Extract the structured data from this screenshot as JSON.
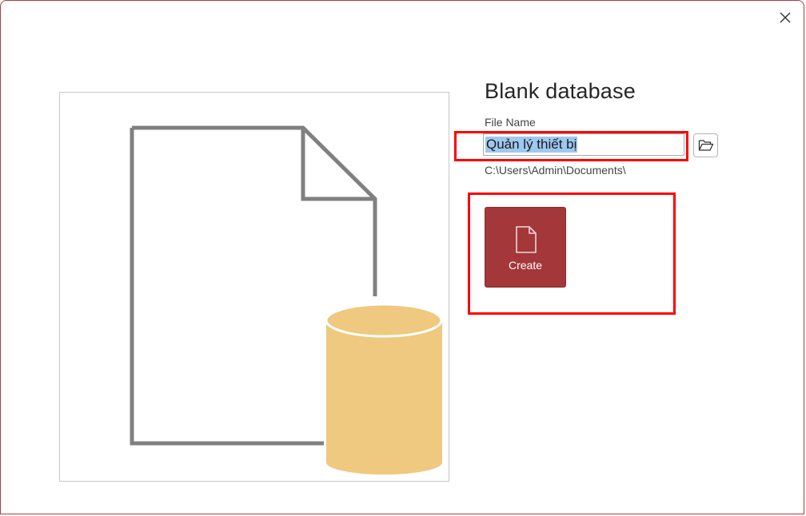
{
  "dialog": {
    "title": "Blank database",
    "file_name_label": "File Name",
    "file_name_value": "Quản lý thiết bị",
    "save_path": "C:\\Users\\Admin\\Documents\\",
    "create_label": "Create"
  },
  "icons": {
    "close": "close-icon",
    "browse": "folder-open-icon",
    "create": "document-icon",
    "preview": "database-document-illustration"
  },
  "colors": {
    "create_button": "#a4373a",
    "selection_highlight": "#9fc8ef",
    "annotation_box": "#ff0000",
    "cylinder": "#eec97f",
    "document_outline": "#808080"
  }
}
